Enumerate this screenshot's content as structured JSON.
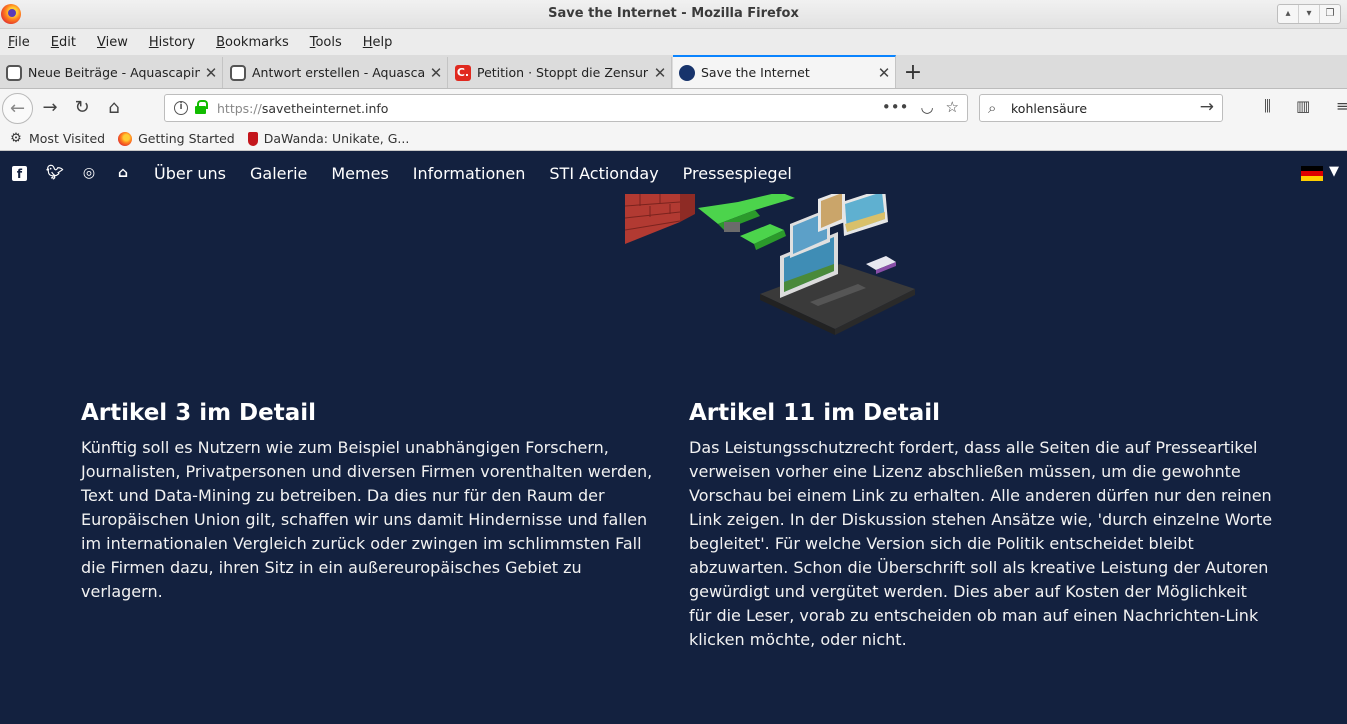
{
  "window": {
    "title": "Save the Internet - Mozilla Firefox"
  },
  "menu": [
    "File",
    "Edit",
    "View",
    "History",
    "Bookmarks",
    "Tools",
    "Help"
  ],
  "tabs": [
    {
      "label": "Neue Beiträge - Aquascaping",
      "icon": "forum-icon",
      "active": false
    },
    {
      "label": "Antwort erstellen - Aquascapi",
      "icon": "forum-icon",
      "active": false
    },
    {
      "label": "Petition · Stoppt die Zensurma",
      "icon": "petition-icon",
      "active": false,
      "icon_text": "C."
    },
    {
      "label": "Save the Internet",
      "icon": "sti-icon",
      "active": true
    }
  ],
  "urlbar": {
    "protocol": "https://",
    "host": "savetheinternet.info",
    "page_actions": "•••"
  },
  "search": {
    "value": "kohlensäure"
  },
  "bookmarks": [
    {
      "label": "Most Visited",
      "icon": "gear-icon"
    },
    {
      "label": "Getting Started",
      "icon": "firefox-icon"
    },
    {
      "label": "DaWanda: Unikate, G...",
      "icon": "dawanda-icon"
    }
  ],
  "site_nav": {
    "items": [
      "Über uns",
      "Galerie",
      "Memes",
      "Informationen",
      "STI Actionday",
      "Pressespiegel"
    ]
  },
  "articles": [
    {
      "title": "Artikel 3 im Detail",
      "body": "Künftig soll es Nutzern wie zum Beispiel unabhängigen Forschern, Journalisten, Privatpersonen und diversen Firmen vorenthalten werden, Text und Data-Mining zu betreiben. Da dies nur für den Raum der Europäischen Union gilt, schaffen wir uns damit Hindernisse und fallen im internationalen Vergleich zurück oder zwingen im schlimmsten Fall die Firmen dazu, ihren Sitz in ein außereuropäisches Gebiet zu verlagern."
    },
    {
      "title": "Artikel 11 im Detail",
      "body": "Das Leistungsschutzrecht fordert, dass alle Seiten die auf Presseartikel verweisen vorher eine Lizenz abschließen müssen, um die gewohnte Vorschau bei einem Link zu erhalten. Alle anderen dürfen nur den reinen Link zeigen. In der Diskussion stehen Ansätze wie, 'durch einzelne Worte begleitet'. Für welche Version sich die Politik entscheidet bleibt abzuwarten. Schon die Überschrift soll als kreative Leistung der Autoren gewürdigt und vergütet werden. Dies aber auf Kosten der Möglichkeit für die Leser, vorab zu entscheiden ob man auf einen Nachrichten-Link klicken möchte, oder nicht."
    }
  ],
  "colors": {
    "page_bg": "#13213f",
    "accent_tab": "#0a84ff",
    "lock_green": "#12bc00"
  }
}
